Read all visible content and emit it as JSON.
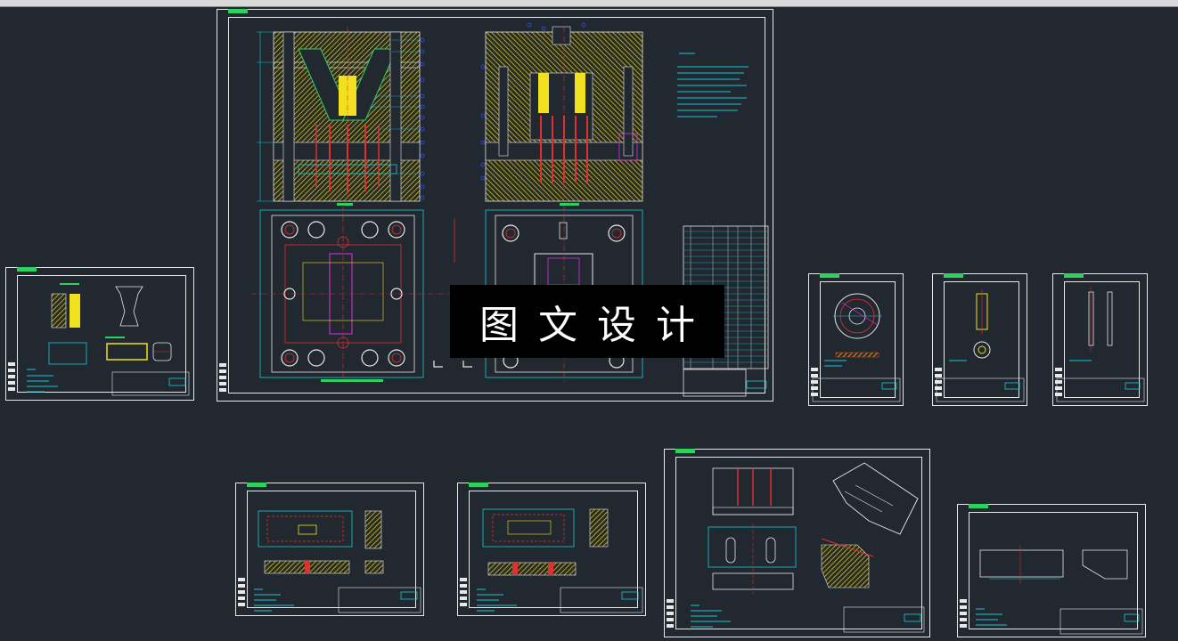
{
  "window": {
    "background": "#212830",
    "topbar_color": "#d9d9d9"
  },
  "watermark": {
    "text": "图文设计"
  },
  "colors": {
    "frame": "#e8e8e8",
    "hatch": "#c9c23a",
    "cyan": "#19c8d8",
    "red": "#e03030",
    "blue": "#3050ff",
    "green": "#2fcf60",
    "magenta": "#e030e0",
    "yellow": "#f0e020"
  },
  "icons": [
    "title-block-icon",
    "dimension-leader-icon",
    "section-mark-icon"
  ]
}
